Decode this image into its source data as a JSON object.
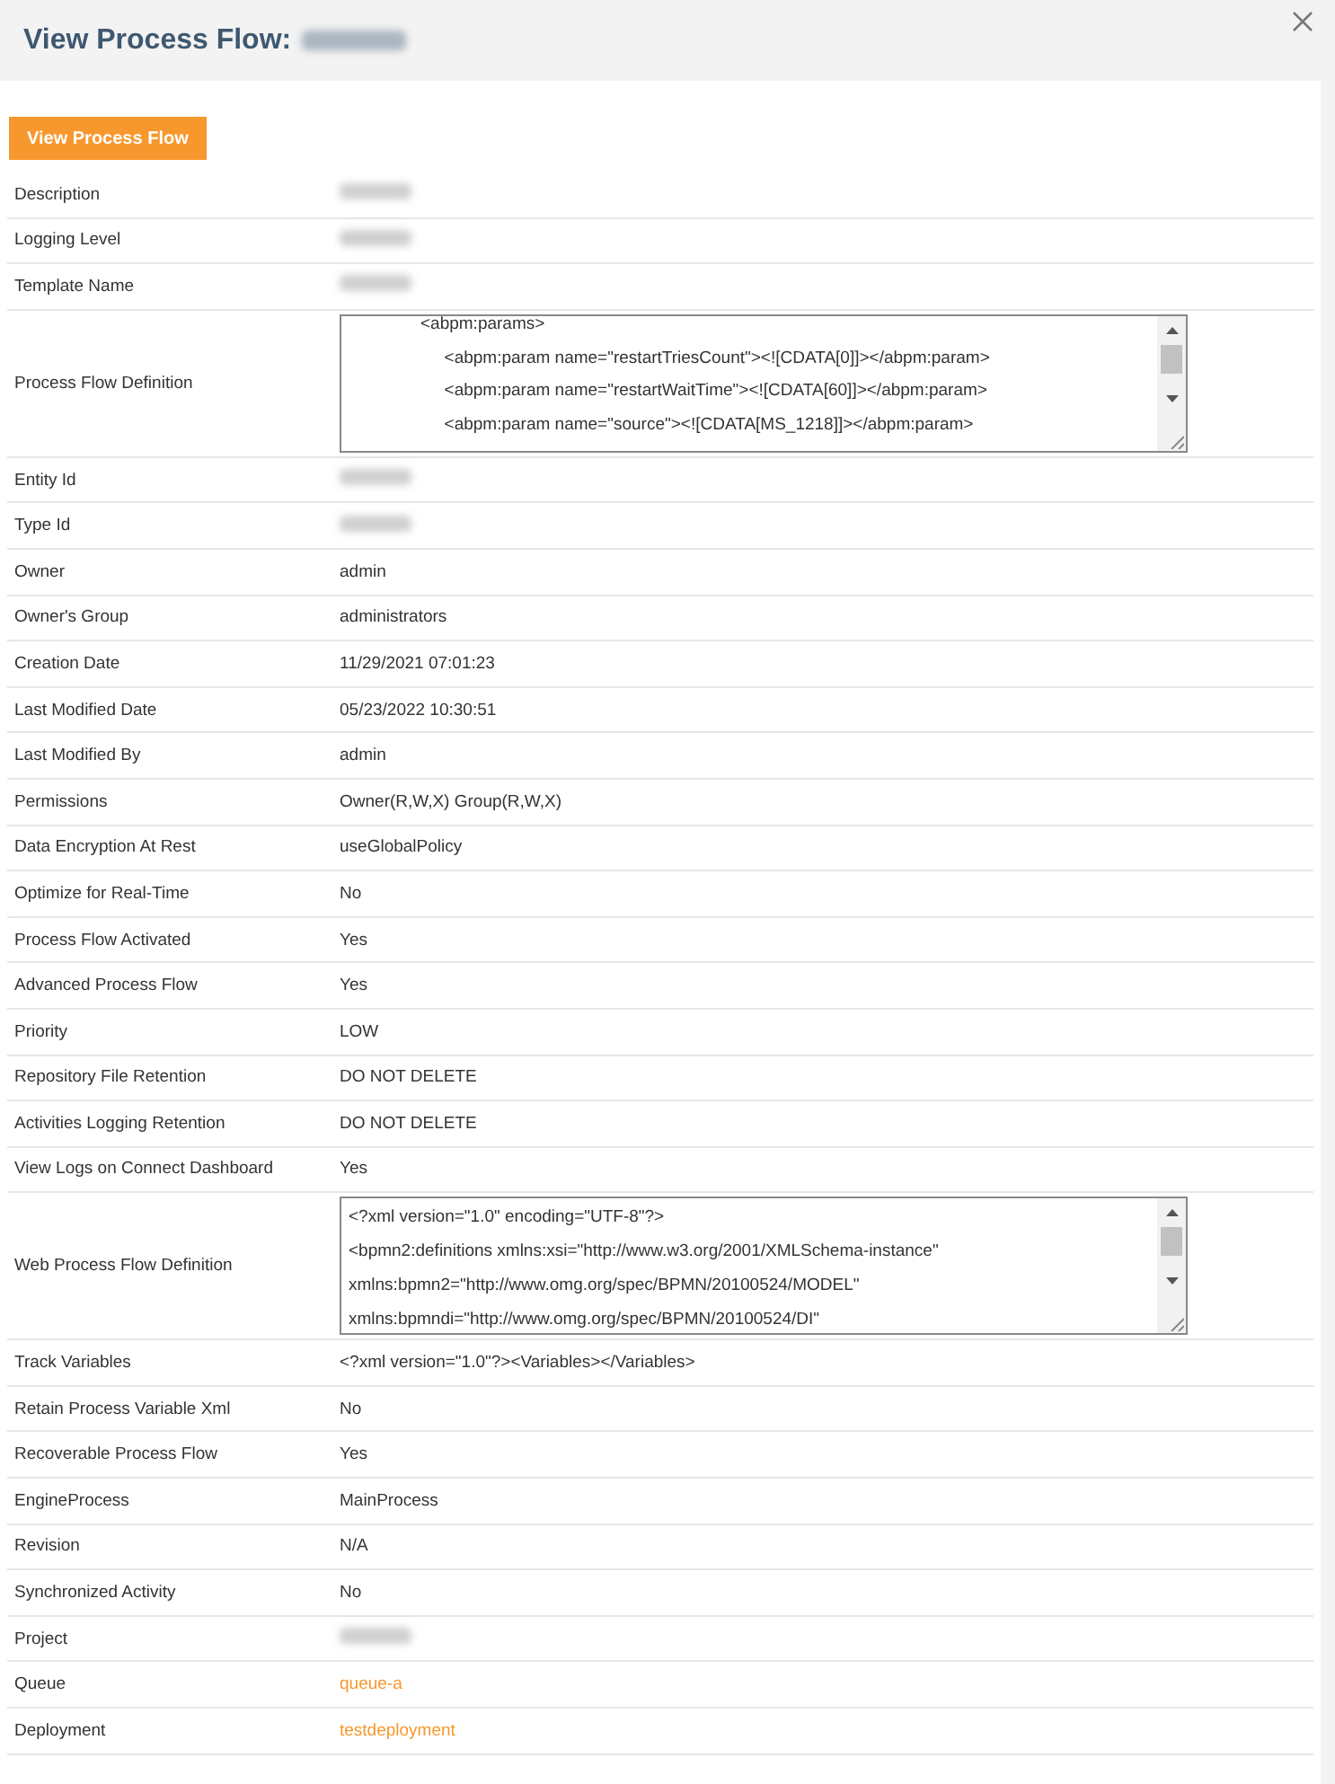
{
  "dialog": {
    "title": "View Process Flow:",
    "title_redacted": true
  },
  "action_button": "View Process Flow",
  "rows": [
    {
      "label": "Description",
      "kind": "redacted"
    },
    {
      "label": "Logging Level",
      "kind": "redacted"
    },
    {
      "label": "Template Name",
      "kind": "redacted"
    },
    {
      "label": "Process Flow Definition",
      "kind": "textarea",
      "lines": [
        "<abpm:params>",
        "  <abpm:param name=\"restartTriesCount\"><![CDATA[0]]></abpm:param>",
        "  <abpm:param name=\"restartWaitTime\"><![CDATA[60]]></abpm:param>",
        "  <abpm:param name=\"source\"><![CDATA[MS_1218]]></abpm:param>"
      ],
      "indented": true
    },
    {
      "label": "Entity Id",
      "kind": "redacted"
    },
    {
      "label": "Type Id",
      "kind": "redacted"
    },
    {
      "label": "Owner",
      "kind": "text",
      "value": "admin"
    },
    {
      "label": "Owner's Group",
      "kind": "text",
      "value": "administrators"
    },
    {
      "label": "Creation Date",
      "kind": "text",
      "value": "11/29/2021 07:01:23"
    },
    {
      "label": "Last Modified Date",
      "kind": "text",
      "value": "05/23/2022 10:30:51"
    },
    {
      "label": "Last Modified By",
      "kind": "text",
      "value": "admin"
    },
    {
      "label": "Permissions",
      "kind": "text",
      "value": "Owner(R,W,X) Group(R,W,X)"
    },
    {
      "label": "Data Encryption At Rest",
      "kind": "text",
      "value": "useGlobalPolicy"
    },
    {
      "label": "Optimize for Real-Time",
      "kind": "text",
      "value": "No"
    },
    {
      "label": "Process Flow Activated",
      "kind": "text",
      "value": "Yes"
    },
    {
      "label": "Advanced Process Flow",
      "kind": "text",
      "value": "Yes"
    },
    {
      "label": "Priority",
      "kind": "text",
      "value": "LOW"
    },
    {
      "label": "Repository File Retention",
      "kind": "text",
      "value": "DO NOT DELETE"
    },
    {
      "label": "Activities Logging Retention",
      "kind": "text",
      "value": "DO NOT DELETE"
    },
    {
      "label": "View Logs on Connect Dashboard",
      "kind": "text",
      "value": "Yes"
    },
    {
      "label": "Web Process Flow Definition",
      "kind": "textarea",
      "lines": [
        "<?xml version=\"1.0\" encoding=\"UTF-8\"?>",
        "<bpmn2:definitions xmlns:xsi=\"http://www.w3.org/2001/XMLSchema-instance\"",
        "xmlns:bpmn2=\"http://www.omg.org/spec/BPMN/20100524/MODEL\"",
        "xmlns:bpmndi=\"http://www.omg.org/spec/BPMN/20100524/DI\""
      ],
      "indented": false
    },
    {
      "label": "Track Variables",
      "kind": "text",
      "value": "<?xml version=\"1.0\"?><Variables></Variables>"
    },
    {
      "label": "Retain Process Variable Xml",
      "kind": "text",
      "value": "No"
    },
    {
      "label": "Recoverable Process Flow",
      "kind": "text",
      "value": "Yes"
    },
    {
      "label": "EngineProcess",
      "kind": "text",
      "value": "MainProcess"
    },
    {
      "label": "Revision",
      "kind": "text",
      "value": "N/A"
    },
    {
      "label": "Synchronized Activity",
      "kind": "text",
      "value": "No"
    },
    {
      "label": "Project",
      "kind": "redacted"
    },
    {
      "label": "Queue",
      "kind": "link",
      "value": "queue-a"
    },
    {
      "label": "Deployment",
      "kind": "link",
      "value": "testdeployment"
    }
  ]
}
